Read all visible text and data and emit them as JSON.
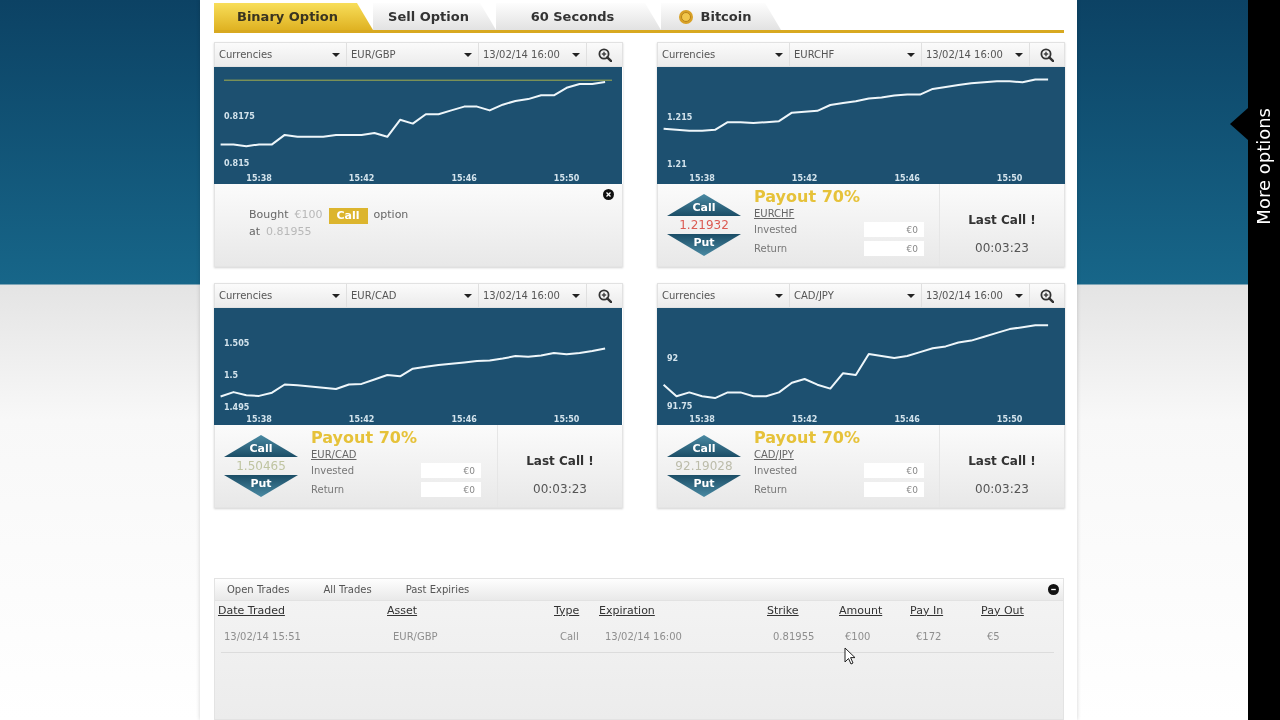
{
  "tabs": [
    {
      "label": "Binary Option",
      "selected": true,
      "icon": false
    },
    {
      "label": "Sell Option",
      "selected": false,
      "icon": false
    },
    {
      "label": "60 Seconds",
      "selected": false,
      "icon": false
    },
    {
      "label": "Bitcoin",
      "selected": false,
      "icon": true
    }
  ],
  "cards": [
    {
      "kind": "receipt",
      "category": "Currencies",
      "asset": "EUR/GBP",
      "expiry": "13/02/14 16:00",
      "chart_data": {
        "type": "line",
        "x": [
          15.6083,
          15.6167,
          15.625,
          15.6333,
          15.6417,
          15.65,
          15.6583,
          15.6667,
          15.675,
          15.6833,
          15.6917,
          15.7,
          15.7083,
          15.7167,
          15.725,
          15.7333,
          15.7417,
          15.75,
          15.7583,
          15.7667,
          15.775,
          15.7833,
          15.7917,
          15.8,
          15.8083,
          15.8167,
          15.825,
          15.8333,
          15.8417,
          15.85,
          15.8583
        ],
        "values": [
          0.816,
          0.816,
          0.8159,
          0.816,
          0.816,
          0.8165,
          0.8164,
          0.8164,
          0.8164,
          0.8165,
          0.8165,
          0.8165,
          0.8166,
          0.8164,
          0.8173,
          0.8171,
          0.8176,
          0.8176,
          0.8178,
          0.818,
          0.818,
          0.8178,
          0.8181,
          0.8183,
          0.8184,
          0.8186,
          0.8186,
          0.819,
          0.8192,
          0.8192,
          0.8193
        ],
        "color": "#eef6fa",
        "xlim": [
          15.604,
          15.8693
        ],
        "ylim": [
          0.8139,
          0.8201
        ],
        "xticks": [
          {
            "value": 15.6333,
            "label": "15:38"
          },
          {
            "value": 15.7,
            "label": "15:42"
          },
          {
            "value": 15.7667,
            "label": "15:46"
          },
          {
            "value": 15.8333,
            "label": "15:50"
          }
        ],
        "yticks": [
          0.815,
          0.8175
        ],
        "ref_lines": [
          {
            "axis": "y",
            "value": 0.8194,
            "color": "#a4ad4c"
          }
        ]
      },
      "receipt": {
        "bought": "Bought",
        "amount": "€100",
        "type": "Call",
        "option": "option",
        "at": "at",
        "price": "0.81955"
      }
    },
    {
      "kind": "trade",
      "category": "Currencies",
      "asset": "EURCHF",
      "expiry": "13/02/14 16:00",
      "chart_data": {
        "type": "line",
        "x": [
          15.6083,
          15.6167,
          15.625,
          15.6333,
          15.6417,
          15.65,
          15.6583,
          15.6667,
          15.675,
          15.6833,
          15.6917,
          15.7,
          15.7083,
          15.7167,
          15.725,
          15.7333,
          15.7417,
          15.75,
          15.7583,
          15.7667,
          15.775,
          15.7833,
          15.7917,
          15.8,
          15.8083,
          15.8167,
          15.825,
          15.8333,
          15.8417,
          15.85,
          15.8583
        ],
        "values": [
          1.2137,
          1.2136,
          1.2135,
          1.2135,
          1.2136,
          1.2144,
          1.2144,
          1.2143,
          1.2144,
          1.2145,
          1.2154,
          1.2155,
          1.2156,
          1.2162,
          1.2164,
          1.2166,
          1.2169,
          1.217,
          1.2172,
          1.2173,
          1.2173,
          1.2179,
          1.2181,
          1.2183,
          1.2185,
          1.2186,
          1.2187,
          1.2187,
          1.2186,
          1.2189,
          1.2189
        ],
        "color": "#eef6fa",
        "xlim": [
          15.604,
          15.8693
        ],
        "ylim": [
          1.2079,
          1.2202
        ],
        "xticks": [
          {
            "value": 15.6333,
            "label": "15:38"
          },
          {
            "value": 15.7,
            "label": "15:42"
          },
          {
            "value": 15.7667,
            "label": "15:46"
          },
          {
            "value": 15.8333,
            "label": "15:50"
          }
        ],
        "yticks": [
          1.21,
          1.215
        ]
      },
      "call": "Call",
      "put": "Put",
      "price": {
        "value": "1.21932",
        "color": "#dc5b53"
      },
      "payout": "Payout 70%",
      "asset_link": "EURCHF",
      "invested_label": "Invested",
      "invested": "€0",
      "return_label": "Return",
      "return": "€0",
      "status": "Last Call !",
      "countdown": "00:03:23"
    },
    {
      "kind": "trade",
      "category": "Currencies",
      "asset": "EUR/CAD",
      "expiry": "13/02/14 16:00",
      "chart_data": {
        "type": "line",
        "x": [
          15.6083,
          15.6167,
          15.625,
          15.6333,
          15.6417,
          15.65,
          15.6583,
          15.6667,
          15.675,
          15.6833,
          15.6917,
          15.7,
          15.7083,
          15.7167,
          15.725,
          15.7333,
          15.7417,
          15.75,
          15.7583,
          15.7667,
          15.775,
          15.7833,
          15.7917,
          15.8,
          15.8083,
          15.8167,
          15.825,
          15.8333,
          15.8417,
          15.85,
          15.8583
        ],
        "values": [
          1.4966,
          1.4973,
          1.4968,
          1.4967,
          1.4972,
          1.4985,
          1.4984,
          1.4982,
          1.498,
          1.4978,
          1.4985,
          1.4986,
          1.4993,
          1.5,
          1.4998,
          1.501,
          1.5013,
          1.5016,
          1.5018,
          1.502,
          1.5022,
          1.5023,
          1.5026,
          1.503,
          1.5029,
          1.5031,
          1.5035,
          1.5033,
          1.5035,
          1.5038,
          1.5042
        ],
        "color": "#eef6fa",
        "xlim": [
          15.604,
          15.8693
        ],
        "ylim": [
          1.4921,
          1.5106
        ],
        "xticks": [
          {
            "value": 15.6333,
            "label": "15:38"
          },
          {
            "value": 15.7,
            "label": "15:42"
          },
          {
            "value": 15.7667,
            "label": "15:46"
          },
          {
            "value": 15.8333,
            "label": "15:50"
          }
        ],
        "yticks": [
          1.495,
          1.5,
          1.505
        ]
      },
      "call": "Call",
      "put": "Put",
      "price": {
        "value": "1.50465",
        "color": "#bfc4a0"
      },
      "payout": "Payout 70%",
      "asset_link": "EUR/CAD",
      "invested_label": "Invested",
      "invested": "€0",
      "return_label": "Return",
      "return": "€0",
      "status": "Last Call !",
      "countdown": "00:03:23"
    },
    {
      "kind": "trade",
      "category": "Currencies",
      "asset": "CAD/JPY",
      "expiry": "13/02/14 16:00",
      "chart_data": {
        "type": "line",
        "x": [
          15.6083,
          15.6167,
          15.625,
          15.6333,
          15.6417,
          15.65,
          15.6583,
          15.6667,
          15.675,
          15.6833,
          15.6917,
          15.7,
          15.7083,
          15.7167,
          15.725,
          15.7333,
          15.7417,
          15.75,
          15.7583,
          15.7667,
          15.775,
          15.7833,
          15.7917,
          15.8,
          15.8083,
          15.8167,
          15.825,
          15.8333,
          15.8417,
          15.85,
          15.8583
        ],
        "values": [
          91.86,
          91.8,
          91.82,
          91.8,
          91.79,
          91.82,
          91.82,
          91.8,
          91.8,
          91.82,
          91.87,
          91.89,
          91.86,
          91.84,
          91.92,
          91.91,
          92.02,
          92.01,
          92.0,
          92.01,
          92.03,
          92.05,
          92.06,
          92.08,
          92.09,
          92.11,
          92.13,
          92.15,
          92.16,
          92.17,
          92.17
        ],
        "color": "#eef6fa",
        "xlim": [
          15.604,
          15.8693
        ],
        "ylim": [
          91.65,
          92.26
        ],
        "xticks": [
          {
            "value": 15.6333,
            "label": "15:38"
          },
          {
            "value": 15.7,
            "label": "15:42"
          },
          {
            "value": 15.7667,
            "label": "15:46"
          },
          {
            "value": 15.8333,
            "label": "15:50"
          }
        ],
        "yticks": [
          91.75,
          92
        ]
      },
      "call": "Call",
      "put": "Put",
      "price": {
        "value": "92.19028",
        "color": "#bcbcaa"
      },
      "payout": "Payout 70%",
      "asset_link": "CAD/JPY",
      "invested_label": "Invested",
      "invested": "€0",
      "return_label": "Return",
      "return": "€0",
      "status": "Last Call !",
      "countdown": "00:03:23"
    }
  ],
  "trades": {
    "tabs": [
      "Open Trades",
      "All Trades",
      "Past Expiries"
    ],
    "columns": [
      "Date Traded",
      "Asset",
      "Type",
      "Expiration",
      "Strike",
      "Amount",
      "Pay In",
      "Pay Out"
    ],
    "rows": [
      [
        "13/02/14 15:51",
        "EUR/GBP",
        "Call",
        "13/02/14 16:00",
        "0.81955",
        "€100",
        "€172",
        "€5"
      ]
    ]
  },
  "side_tab": {
    "label": "More options"
  }
}
